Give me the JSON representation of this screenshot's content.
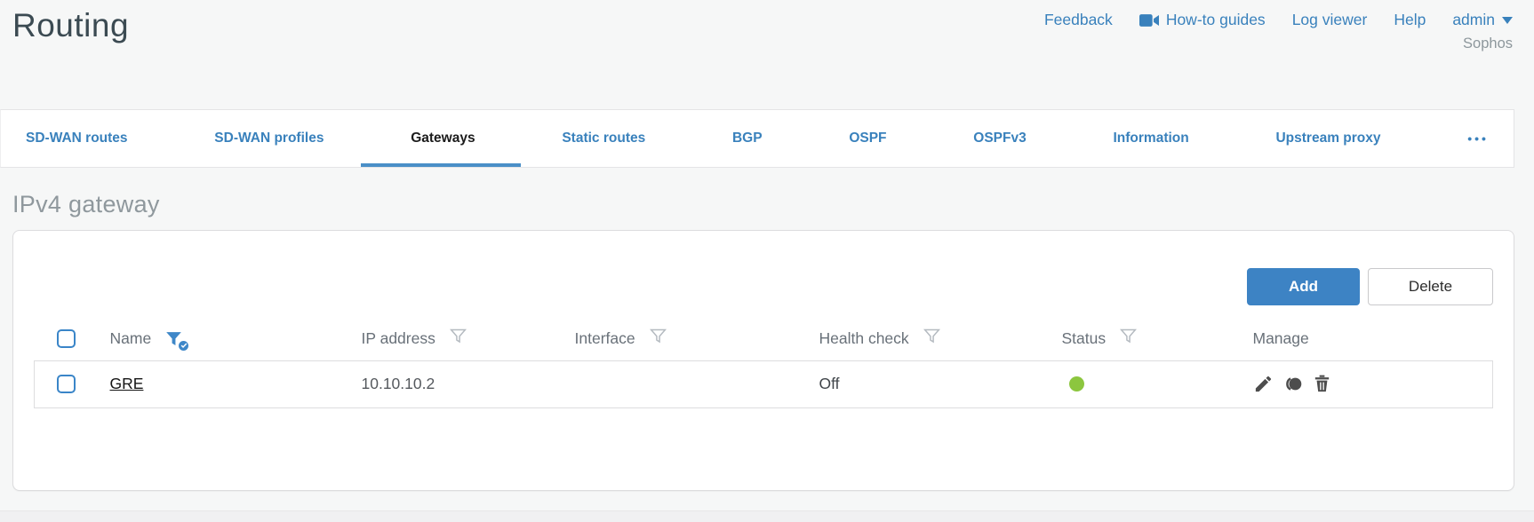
{
  "page": {
    "title": "Routing",
    "brand": "Sophos"
  },
  "header_links": [
    {
      "label": "Feedback"
    },
    {
      "label": "How-to guides",
      "icon": "video-camera-icon"
    },
    {
      "label": "Log viewer"
    },
    {
      "label": "Help"
    },
    {
      "label": "admin",
      "icon": "caret-down-icon"
    }
  ],
  "tabs": [
    {
      "label": "SD-WAN routes",
      "active": false
    },
    {
      "label": "SD-WAN profiles",
      "active": false
    },
    {
      "label": "Gateways",
      "active": true
    },
    {
      "label": "Static routes",
      "active": false
    },
    {
      "label": "BGP",
      "active": false
    },
    {
      "label": "OSPF",
      "active": false
    },
    {
      "label": "OSPFv3",
      "active": false
    },
    {
      "label": "Information",
      "active": false
    },
    {
      "label": "Upstream proxy",
      "active": false
    },
    {
      "label": "•••",
      "overflow": true
    }
  ],
  "section": {
    "heading": "IPv4 gateway"
  },
  "toolbar": {
    "add_label": "Add",
    "delete_label": "Delete"
  },
  "table": {
    "columns": [
      {
        "label": "Name",
        "filter": "active"
      },
      {
        "label": "IP address",
        "filter": "inactive"
      },
      {
        "label": "Interface",
        "filter": "inactive"
      },
      {
        "label": "Health check",
        "filter": "inactive"
      },
      {
        "label": "Status",
        "filter": "inactive"
      },
      {
        "label": "Manage",
        "filter": "none"
      }
    ],
    "rows": [
      {
        "name": "GRE",
        "ip_address": "10.10.10.2",
        "interface": "",
        "health_check": "Off",
        "status": "up",
        "manage": [
          "edit-icon",
          "clone-icon",
          "delete-icon"
        ]
      }
    ]
  },
  "colors": {
    "accent_blue": "#3981bc",
    "button_blue": "#3d83c4",
    "status_green": "#8cc63f",
    "title_gray": "#3b4a52",
    "heading_gray": "#8f989d"
  }
}
